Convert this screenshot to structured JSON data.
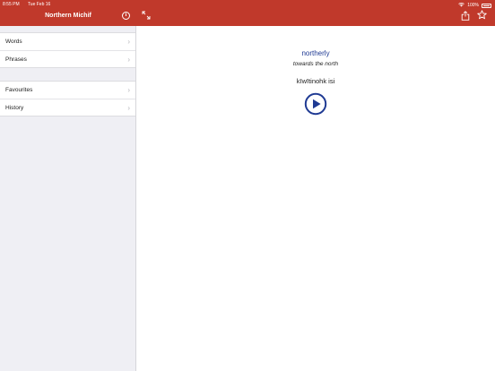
{
  "status_bar": {
    "time": "8:55 PM",
    "date": "Tue Feb 16",
    "battery": "100%"
  },
  "sidebar": {
    "title": "Northern Michif",
    "groups": [
      {
        "items": [
          {
            "label": "Words"
          },
          {
            "label": "Phrases"
          }
        ]
      },
      {
        "items": [
          {
            "label": "Favourites"
          },
          {
            "label": "History"
          }
        ]
      }
    ]
  },
  "entry": {
    "word": "northerly",
    "translation": "towards the north",
    "michif": "kīwītinohk isi"
  },
  "icons": {
    "info": "info-icon",
    "expand": "expand-icon",
    "share": "share-icon",
    "favourite": "star-icon",
    "play": "play-icon",
    "chevron": "chevron-right-icon"
  },
  "colors": {
    "accent": "#c0392b",
    "link": "#1f3a93"
  }
}
